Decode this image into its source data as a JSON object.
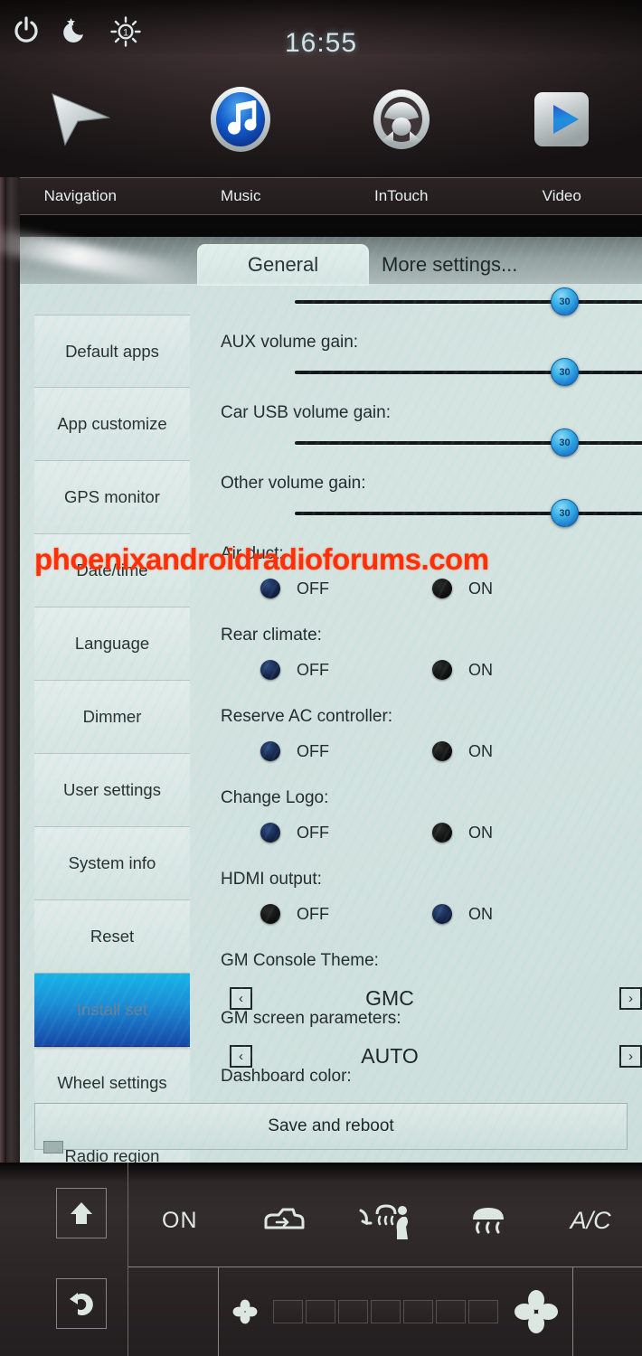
{
  "statusbar": {
    "clock": "16:55",
    "icons": [
      {
        "name": "power-icon",
        "glyph": "power"
      },
      {
        "name": "night-mode-icon",
        "glyph": "moon-star"
      },
      {
        "name": "brightness-icon",
        "glyph": "sun",
        "value": "1"
      }
    ]
  },
  "launcher": {
    "apps": [
      {
        "label": "Navigation",
        "icon": "navigation-arrow-icon"
      },
      {
        "label": "Music",
        "icon": "music-note-icon"
      },
      {
        "label": "InTouch",
        "icon": "steering-wheel-icon"
      },
      {
        "label": "Video",
        "icon": "play-button-icon"
      }
    ]
  },
  "settings": {
    "tabs": [
      {
        "label": "General",
        "active": true
      },
      {
        "label": "More settings...",
        "active": false
      }
    ],
    "menu": [
      {
        "label": "Default apps",
        "selected": false
      },
      {
        "label": "App customize",
        "selected": false
      },
      {
        "label": "GPS monitor",
        "selected": false
      },
      {
        "label": "Date/time",
        "selected": false
      },
      {
        "label": "Language",
        "selected": false
      },
      {
        "label": "Dimmer",
        "selected": false
      },
      {
        "label": "User settings",
        "selected": false
      },
      {
        "label": "System info",
        "selected": false
      },
      {
        "label": "Reset",
        "selected": false
      },
      {
        "label": "Install set",
        "selected": true
      },
      {
        "label": "Wheel settings",
        "selected": false
      },
      {
        "label": "Radio region",
        "selected": false
      }
    ],
    "sliders": [
      {
        "label": "",
        "value": "30",
        "percent": 84
      },
      {
        "label": "AUX volume gain:",
        "value": "30",
        "percent": 84
      },
      {
        "label": "Car USB volume gain:",
        "value": "30",
        "percent": 84
      },
      {
        "label": "Other volume gain:",
        "value": "30",
        "percent": 84
      }
    ],
    "toggles": [
      {
        "label": "Air duct:",
        "off_label": "OFF",
        "on_label": "ON",
        "selected": "OFF"
      },
      {
        "label": "Rear climate:",
        "off_label": "OFF",
        "on_label": "ON",
        "selected": "OFF"
      },
      {
        "label": "Reserve AC controller:",
        "off_label": "OFF",
        "on_label": "ON",
        "selected": "OFF"
      },
      {
        "label": "Change Logo:",
        "off_label": "OFF",
        "on_label": "ON",
        "selected": "OFF"
      },
      {
        "label": "HDMI output:",
        "off_label": "OFF",
        "on_label": "ON",
        "selected": "ON"
      }
    ],
    "steppers": [
      {
        "label": "GM Console Theme:",
        "value": "GMC",
        "prev": "‹",
        "next": "›"
      },
      {
        "label": "GM screen parameters:",
        "value": "AUTO",
        "prev": "‹",
        "next": "›"
      }
    ],
    "trailing_label": "Dashboard color:",
    "save_button": "Save and reboot"
  },
  "watermark": "phoenixandroidradioforums.com",
  "hvac": {
    "power_label": "ON",
    "ac_label": "A/C",
    "buttons": [
      {
        "name": "up-arrow-button",
        "icon": "up-arrow-icon"
      },
      {
        "name": "back-button",
        "icon": "back-arrow-icon"
      }
    ],
    "mode_icons": [
      {
        "name": "recirculation-icon"
      },
      {
        "name": "front-defrost-feet-icon"
      },
      {
        "name": "rear-defrost-icon"
      }
    ],
    "fan_segments": 7,
    "fan_level": 0
  },
  "colors": {
    "accent_blue": "#1b8ed6",
    "watermark_red": "#ff3008",
    "panel_bg": "#d6e4e1",
    "topbar_bg": "#332a2b"
  }
}
